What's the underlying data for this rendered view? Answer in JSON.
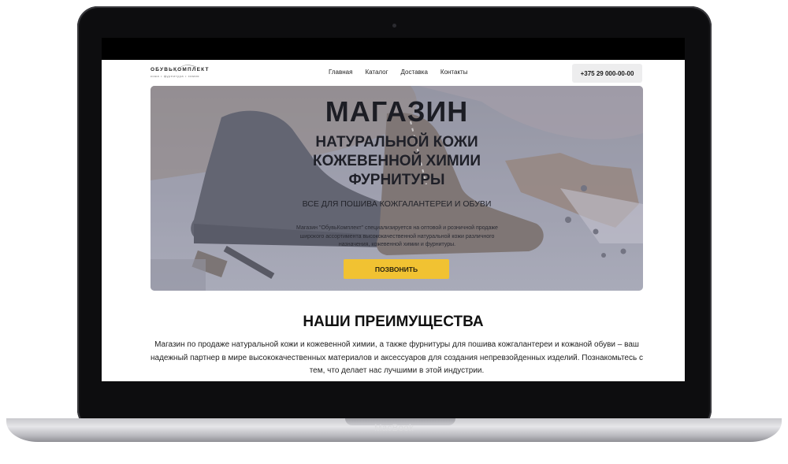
{
  "device": {
    "brand_label": "MacBook"
  },
  "site": {
    "logo": {
      "name": "ОБУВЬКОМПЛЕКТ",
      "tagline": "кожа • фурнитура • химия"
    },
    "nav": [
      "Главная",
      "Каталог",
      "Доставка",
      "Контакты"
    ],
    "phone": "+375 29 000-00-00",
    "hero": {
      "title": "МАГАЗИН",
      "subtitle_lines": [
        "НАТУРАЛЬНОЙ КОЖИ",
        "КОЖЕВЕННОЙ ХИМИИ",
        "ФУРНИТУРЫ"
      ],
      "tagline": "ВСЕ ДЛЯ ПОШИВА КОЖГАЛАНТЕРЕИ И ОБУВИ",
      "description": "Магазин \"ОбувьКомплект\" специализируется на оптовой и розничной продаже широкого ассортимента высококачественной натуральной кожи различного назначения, кожевенной химии и фурнитуры.",
      "cta": "ПОЗВОНИТЬ"
    },
    "advantages": {
      "title": "НАШИ ПРЕИМУЩЕСТВА",
      "text": "Магазин по продаже натуральной кожи и кожевенной химии, а также фурнитуры для пошива кожгалантереи и кожаной обуви – ваш надежный партнер в мире высококачественных материалов и аксессуаров для создания непревзойденных изделий. Познакомьтесь с тем, что делает нас лучшими в этой индустрии."
    }
  },
  "colors": {
    "accent": "#f1c232",
    "frame": "#0d0d0f",
    "text": "#111111"
  }
}
